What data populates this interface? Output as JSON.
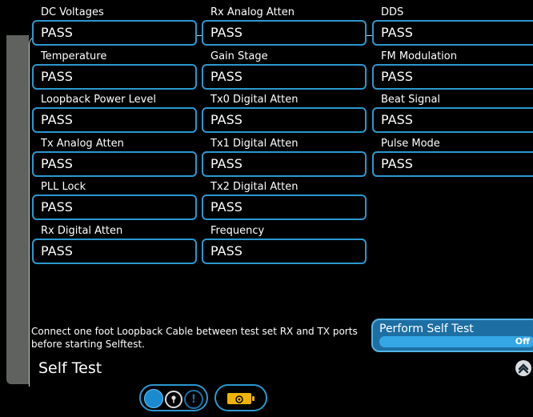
{
  "tests": [
    {
      "label": "DC Voltages",
      "value": "PASS"
    },
    {
      "label": "Temperature",
      "value": "PASS"
    },
    {
      "label": "Loopback Power Level",
      "value": "PASS"
    },
    {
      "label": "Tx Analog Atten",
      "value": "PASS"
    },
    {
      "label": "PLL Lock",
      "value": "PASS"
    },
    {
      "label": "Rx Digital Atten",
      "value": "PASS"
    },
    {
      "label": "Rx Analog Atten",
      "value": "PASS"
    },
    {
      "label": "Gain Stage",
      "value": "PASS"
    },
    {
      "label": "Tx0 Digital Atten",
      "value": "PASS"
    },
    {
      "label": "Tx1 Digital Atten",
      "value": "PASS"
    },
    {
      "label": "Tx2 Digital Atten",
      "value": "PASS"
    },
    {
      "label": "Frequency",
      "value": "PASS"
    },
    {
      "label": "DDS",
      "value": "PASS"
    },
    {
      "label": "FM Modulation",
      "value": "PASS"
    },
    {
      "label": "Beat Signal",
      "value": "PASS"
    },
    {
      "label": "Pulse Mode",
      "value": "PASS"
    }
  ],
  "message": "Connect one foot Loopback Cable between test set RX and TX ports before starting Selftest.",
  "page_title": "Self Test",
  "perform_button": {
    "label": "Perform Self Test",
    "state": "Off"
  },
  "icons": {
    "scroll_up": "chevron-up-icon",
    "status_dot": "status-dot-icon",
    "key": "key-icon",
    "warning": "warning-icon",
    "battery": "battery-icon"
  },
  "colors": {
    "accent": "#2b98cf",
    "button_blue": "#1d6fa3",
    "battery": "#f0b400",
    "background": "#000000"
  }
}
